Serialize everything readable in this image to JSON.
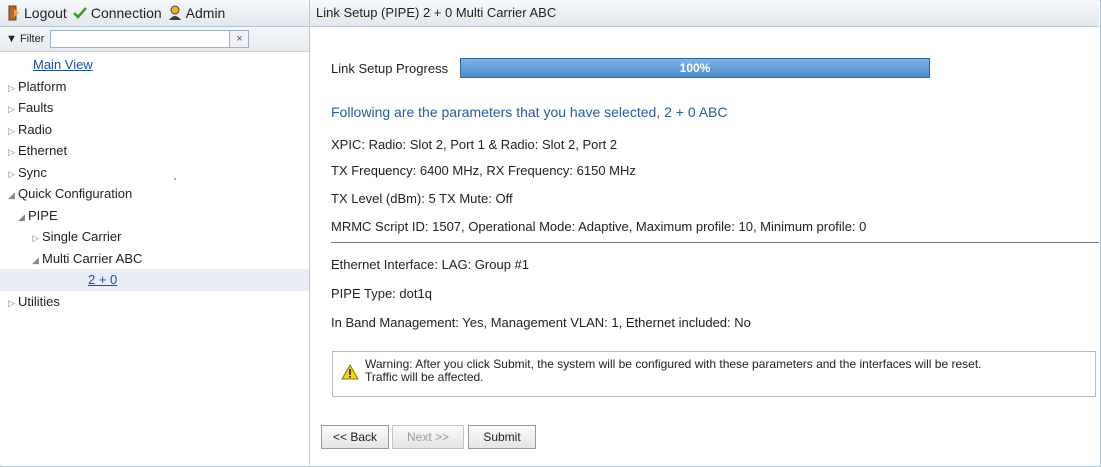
{
  "toolbar": {
    "logout_label": "Logout",
    "connection_label": "Connection",
    "admin_label": "Admin"
  },
  "filter": {
    "label": "Filter",
    "value": "",
    "clear_glyph": "×"
  },
  "tree": {
    "main_view": "Main View",
    "platform": "Platform",
    "faults": "Faults",
    "radio": "Radio",
    "ethernet": "Ethernet",
    "sync": "Sync",
    "quick_configuration": "Quick Configuration",
    "pipe": "PIPE",
    "single_carrier": "Single Carrier",
    "multi_carrier": "Multi Carrier ABC",
    "two_plus_zero": "2 + 0",
    "utilities": "Utilities"
  },
  "page": {
    "title": "Link Setup (PIPE) 2 + 0 Multi Carrier ABC",
    "progress_label": "Link Setup Progress",
    "progress_value": 1.0,
    "progress_text": "100%",
    "params_heading": "Following are the parameters that you have selected, 2 + 0 ABC",
    "xpic": "XPIC: Radio: Slot 2, Port 1 & Radio: Slot 2, Port 2",
    "tx_frequency": "TX Frequency: 6400 MHz, RX Frequency: 6150 MHz",
    "tx_level": "TX Level (dBm): 5 TX Mute: Off",
    "mrmc": "MRMC Script ID: 1507, Operational Mode: Adaptive, Maximum profile: 10, Minimum profile: 0",
    "ethernet_interface": "Ethernet Interface: LAG: Group #1",
    "pipe_type": "PIPE Type: dot1q",
    "in_band": "In Band Management: Yes, Management VLAN: 1, Ethernet included: No",
    "warning_line1": "Warning: After you click Submit, the system will be configured with these parameters and the interfaces will be reset.",
    "warning_line2": "Traffic will be affected."
  },
  "buttons": {
    "back": "<< Back",
    "next": "Next >>",
    "submit": "Submit"
  },
  "colors": {
    "accent": "#2a5b9a",
    "progress_fill": "#4a8ccb",
    "warning_icon": "#f2d21b"
  },
  "icons": {
    "logout": "logout-icon",
    "connection": "check-icon",
    "admin": "user-icon",
    "warning": "warning-icon"
  }
}
